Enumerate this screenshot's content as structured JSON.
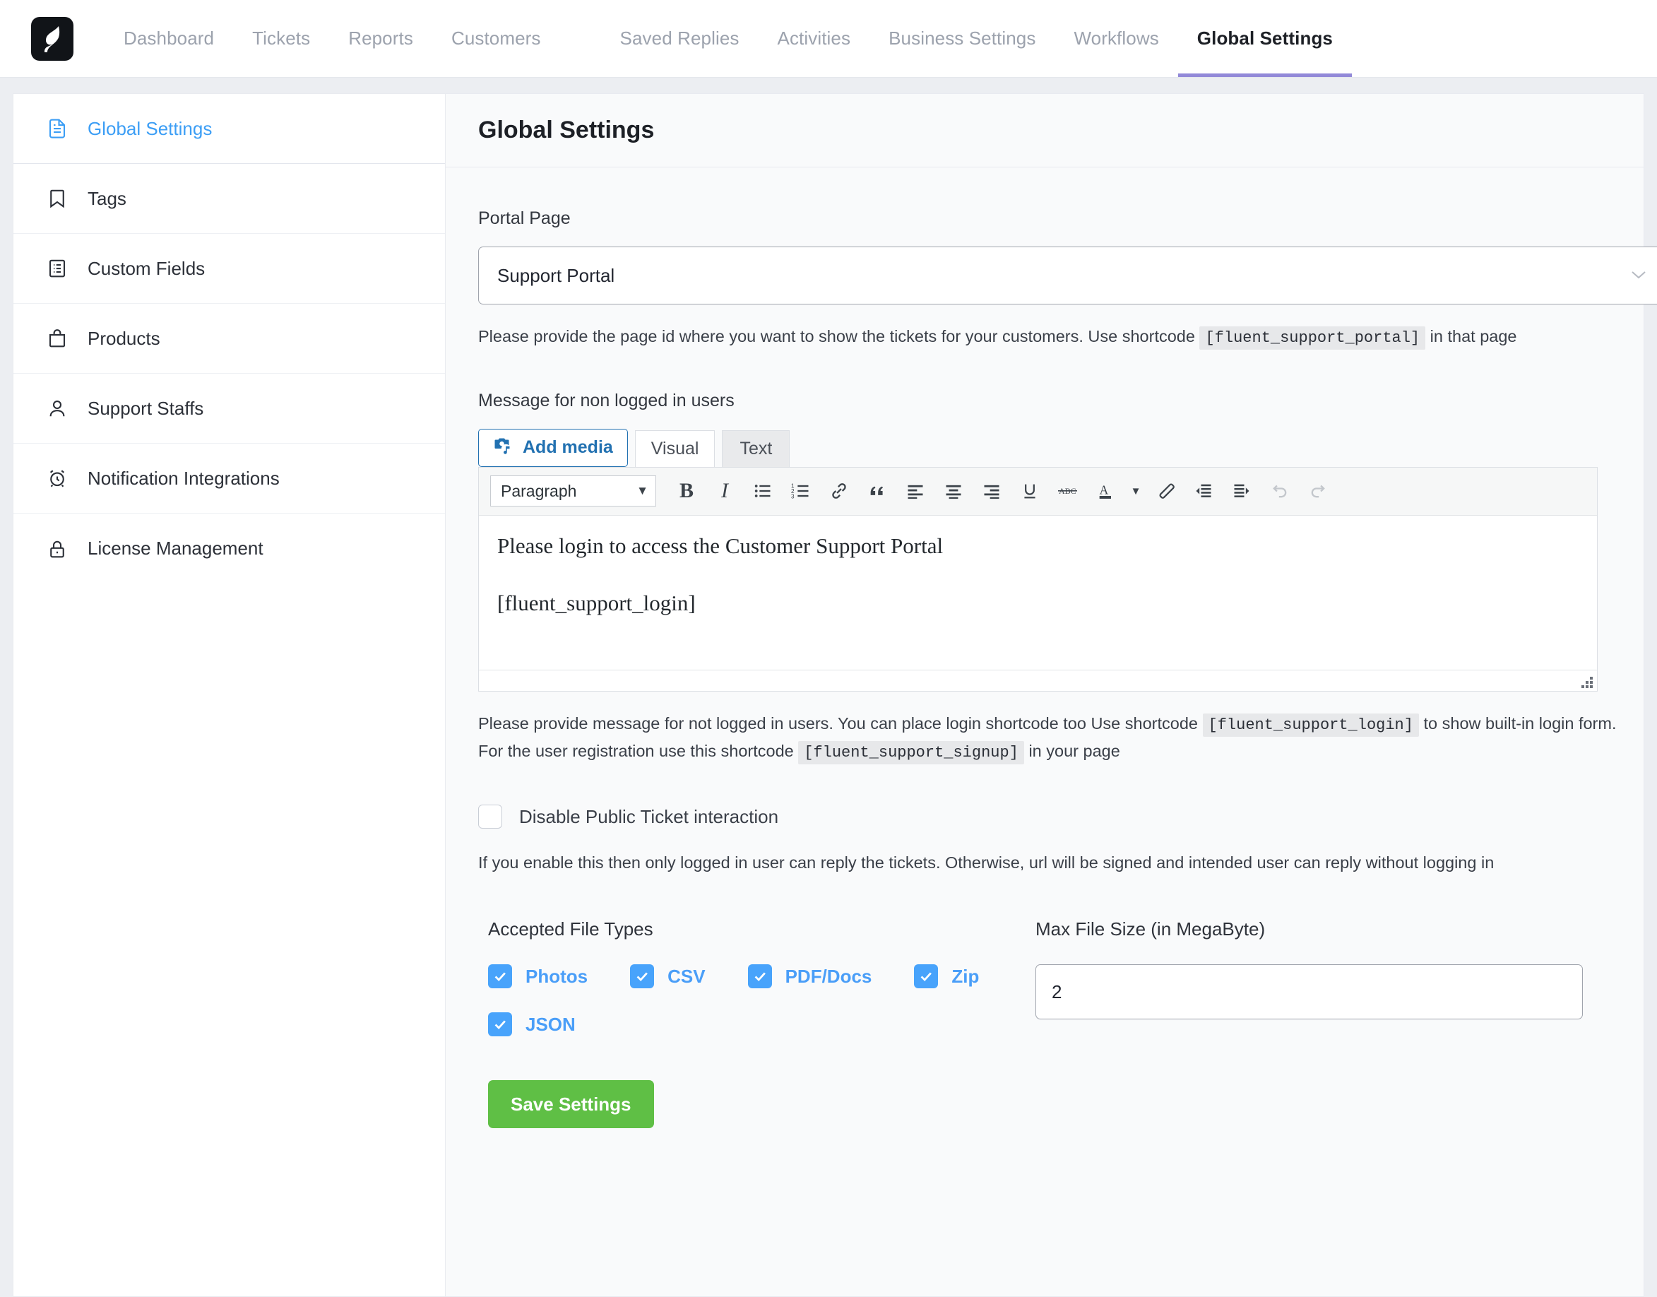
{
  "topnav": {
    "logo_name": "fluent-support-logo",
    "items": [
      {
        "label": "Dashboard",
        "active": false
      },
      {
        "label": "Tickets",
        "active": false
      },
      {
        "label": "Reports",
        "active": false
      },
      {
        "label": "Customers",
        "active": false
      },
      {
        "label": "Saved Replies",
        "active": false
      },
      {
        "label": "Activities",
        "active": false
      },
      {
        "label": "Business Settings",
        "active": false
      },
      {
        "label": "Workflows",
        "active": false
      },
      {
        "label": "Global Settings",
        "active": true
      }
    ],
    "active_underline_color": "#9289d8"
  },
  "sidebar": {
    "items": [
      {
        "label": "Global Settings",
        "icon": "document-icon",
        "active": true
      },
      {
        "label": "Tags",
        "icon": "bookmark-icon",
        "active": false
      },
      {
        "label": "Custom Fields",
        "icon": "list-document-icon",
        "active": false
      },
      {
        "label": "Products",
        "icon": "bag-icon",
        "active": false
      },
      {
        "label": "Support Staffs",
        "icon": "user-icon",
        "active": false
      },
      {
        "label": "Notification Integrations",
        "icon": "alarm-clock-icon",
        "active": false
      },
      {
        "label": "License Management",
        "icon": "lock-icon",
        "active": false
      }
    ],
    "active_color": "#3c9ef5"
  },
  "page": {
    "title": "Global Settings"
  },
  "portal_page": {
    "label": "Portal Page",
    "selected": "Support Portal",
    "help_prefix": "Please provide the page id where you want to show the tickets for your customers. Use shortcode",
    "shortcode": "[fluent_support_portal]",
    "help_suffix": "in that page"
  },
  "message_editor": {
    "label": "Message for non logged in users",
    "add_media_label": "Add media",
    "tab_visual": "Visual",
    "tab_text": "Text",
    "toolbar": {
      "format_select": "Paragraph",
      "buttons": [
        "bold-icon",
        "italic-icon",
        "bulleted-list-icon",
        "numbered-list-icon",
        "link-icon",
        "blockquote-icon",
        "align-left-icon",
        "align-center-icon",
        "align-right-icon",
        "underline-icon",
        "strikethrough-icon",
        "text-color-icon",
        "clear-formatting-icon",
        "outdent-icon",
        "indent-icon",
        "undo-icon",
        "redo-icon"
      ]
    },
    "content_line1": "Please login to access the Customer Support Portal",
    "content_line2": "[fluent_support_login]",
    "help_part1": "Please provide message for not logged in users. You can place login shortcode too Use shortcode",
    "help_shortcode1": "[fluent_support_login]",
    "help_part2": "to show built-in login form. For the user registration use this shortcode",
    "help_shortcode2": "[fluent_support_signup]",
    "help_part3": "in your page"
  },
  "disable_public": {
    "label": "Disable Public Ticket interaction",
    "checked": false,
    "help": "If you enable this then only logged in user can reply the tickets. Otherwise, url will be signed and intended user can reply without logging in"
  },
  "file_types": {
    "label": "Accepted File Types",
    "options": [
      {
        "label": "Photos",
        "checked": true
      },
      {
        "label": "CSV",
        "checked": true
      },
      {
        "label": "PDF/Docs",
        "checked": true
      },
      {
        "label": "Zip",
        "checked": true
      },
      {
        "label": "JSON",
        "checked": true
      }
    ],
    "checked_color": "#48a3fb"
  },
  "max_file_size": {
    "label": "Max File Size (in MegaByte)",
    "value": "2"
  },
  "save_button": {
    "label": "Save Settings",
    "color": "#5fbf45"
  }
}
